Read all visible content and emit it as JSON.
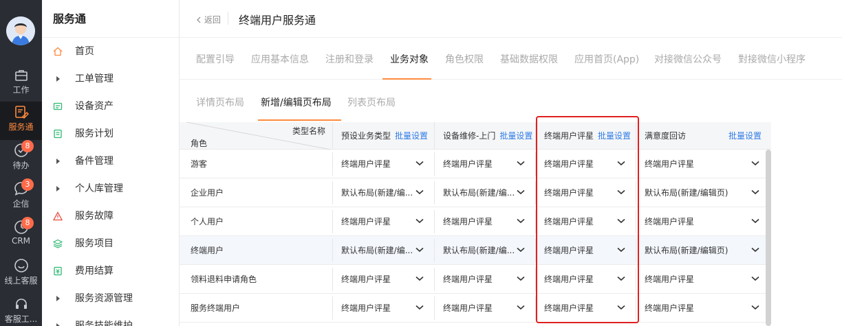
{
  "rail": {
    "items": [
      {
        "label": "工作",
        "icon": "briefcase-icon"
      },
      {
        "label": "服务通",
        "icon": "service-icon",
        "active": true
      },
      {
        "label": "待办",
        "icon": "todo-icon",
        "badge": "8"
      },
      {
        "label": "企信",
        "icon": "chat-icon",
        "badge": "3"
      },
      {
        "label": "CRM",
        "icon": "crm-icon",
        "badge": "8"
      },
      {
        "label": "线上客服",
        "icon": "online-service-icon"
      },
      {
        "label": "客服工...",
        "icon": "headset-icon"
      }
    ]
  },
  "sidebar": {
    "title": "服务通",
    "items": [
      {
        "label": "首页",
        "icon": "home-icon"
      },
      {
        "label": "工单管理",
        "icon": "caret-right-icon"
      },
      {
        "label": "设备资产",
        "icon": "device-icon"
      },
      {
        "label": "服务计划",
        "icon": "plan-icon"
      },
      {
        "label": "备件管理",
        "icon": "caret-right-icon"
      },
      {
        "label": "个人库管理",
        "icon": "caret-right-icon"
      },
      {
        "label": "服务故障",
        "icon": "warning-icon"
      },
      {
        "label": "服务项目",
        "icon": "layers-icon"
      },
      {
        "label": "费用结算",
        "icon": "billing-icon"
      },
      {
        "label": "服务资源管理",
        "icon": "caret-right-icon"
      },
      {
        "label": "服务技能维护",
        "icon": "caret-right-icon"
      }
    ]
  },
  "header": {
    "back_label": "返回",
    "title": "终端用户服务通"
  },
  "tabs": [
    "配置引导",
    "应用基本信息",
    "注册和登录",
    "业务对象",
    "角色权限",
    "基础数据权限",
    "应用首页(App)",
    "对接微信公众号",
    "對接微信小程序"
  ],
  "subtabs": [
    "详情页布局",
    "新增/编辑页布局",
    "列表页布局"
  ],
  "table": {
    "corner_type": "类型名称",
    "corner_role": "角色",
    "bulk_label": "批量设置",
    "columns": [
      "预设业务类型",
      "设备维修-上门",
      "终端用户评星",
      "满意度回访"
    ],
    "rows": [
      {
        "role": "游客",
        "values": [
          "终端用户评星",
          "终端用户评星",
          "终端用户评星",
          "终端用户评星"
        ]
      },
      {
        "role": "企业用户",
        "values": [
          "默认布局(新建/编...",
          "默认布局(新建/编...",
          "终端用户评星",
          "默认布局(新建/编辑页)"
        ]
      },
      {
        "role": "个人用户",
        "values": [
          "终端用户评星",
          "终端用户评星",
          "终端用户评星",
          "终端用户评星"
        ]
      },
      {
        "role": "终端用户",
        "values": [
          "默认布局(新建/编...",
          "默认布局(新建/编...",
          "终端用户评星",
          "默认布局(新建/编辑页)"
        ]
      },
      {
        "role": "领料退料申请角色",
        "values": [
          "终端用户评星",
          "终端用户评星",
          "终端用户评星",
          "终端用户评星"
        ]
      },
      {
        "role": "服务终端用户",
        "values": [
          "终端用户评星",
          "终端用户评星",
          "终端用户评星",
          "终端用户评星"
        ]
      }
    ]
  },
  "colors": {
    "accent": "#ff8a3d",
    "link": "#2f7be6",
    "highlight_box": "#e02020",
    "rail_bg": "#2a2d33"
  }
}
